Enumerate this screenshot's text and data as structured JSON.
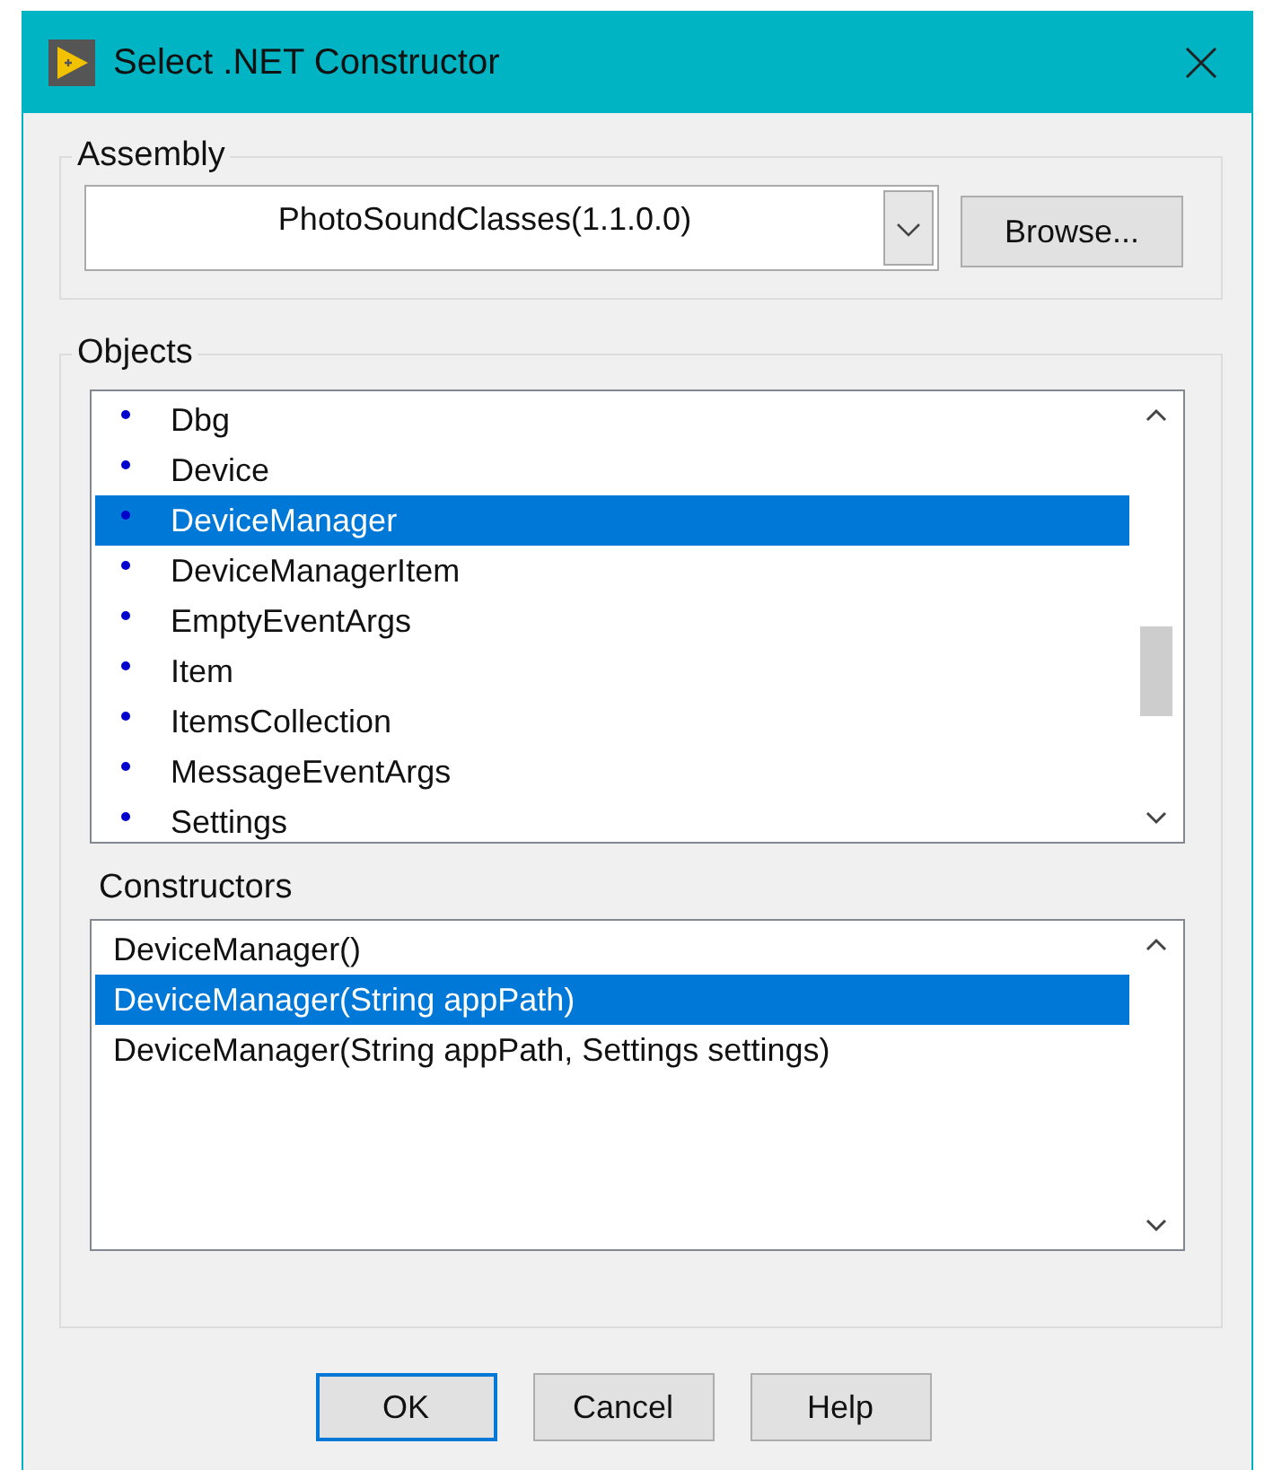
{
  "window": {
    "title": "Select .NET Constructor"
  },
  "assembly": {
    "label": "Assembly",
    "value": "PhotoSoundClasses(1.1.0.0)",
    "browse_button": "Browse..."
  },
  "objects": {
    "label": "Objects",
    "items": [
      {
        "name": "Dbg",
        "selected": false
      },
      {
        "name": "Device",
        "selected": false
      },
      {
        "name": "DeviceManager",
        "selected": true
      },
      {
        "name": "DeviceManagerItem",
        "selected": false
      },
      {
        "name": "EmptyEventArgs",
        "selected": false
      },
      {
        "name": "Item",
        "selected": false
      },
      {
        "name": "ItemsCollection",
        "selected": false
      },
      {
        "name": "MessageEventArgs",
        "selected": false
      },
      {
        "name": "Settings",
        "selected": false
      }
    ]
  },
  "constructors": {
    "label": "Constructors",
    "items": [
      {
        "name": "DeviceManager()",
        "selected": false
      },
      {
        "name": "DeviceManager(String appPath)",
        "selected": true
      },
      {
        "name": "DeviceManager(String appPath, Settings settings)",
        "selected": false
      }
    ]
  },
  "buttons": [
    {
      "label": "OK",
      "default": true
    },
    {
      "label": "Cancel",
      "default": false
    },
    {
      "label": "Help",
      "default": false
    }
  ]
}
